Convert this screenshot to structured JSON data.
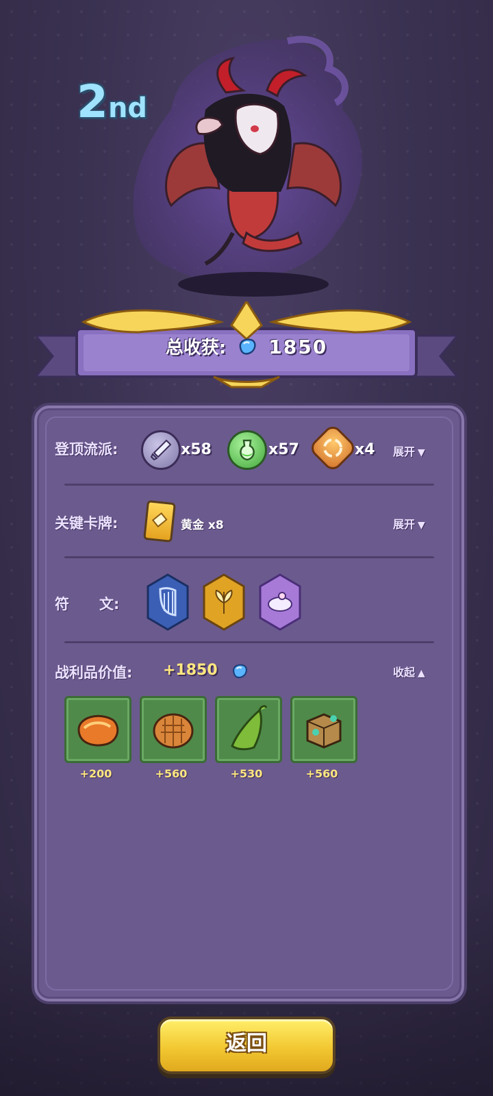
{
  "rank": {
    "number": "2",
    "suffix": "nd"
  },
  "banner": {
    "total_label": "总收获:",
    "total_value": "1850"
  },
  "rows": {
    "climb": {
      "label": "登顶流派:",
      "items": [
        {
          "icon": "sword-icon",
          "count": "x58"
        },
        {
          "icon": "potion-icon",
          "count": "x57"
        },
        {
          "icon": "swirl-icon",
          "count": "x4"
        }
      ],
      "toggle": "展开"
    },
    "cards": {
      "label": "关键卡牌:",
      "card_name": "黄金",
      "card_count": "x8",
      "toggle": "展开"
    },
    "runes": {
      "label_char1": "符",
      "label_char2": "文:",
      "items": [
        "harp-rune-icon",
        "wheat-rune-icon",
        "cauldron-rune-icon"
      ]
    },
    "loot": {
      "label": "战利品价值:",
      "value": "+1850",
      "toggle": "收起",
      "items": [
        {
          "icon": "pie-icon",
          "amount": "+200"
        },
        {
          "icon": "bread-icon",
          "amount": "+560"
        },
        {
          "icon": "horn-icon",
          "amount": "+530"
        },
        {
          "icon": "chest-icon",
          "amount": "+560"
        }
      ]
    }
  },
  "back_button": "返回",
  "colors": {
    "panel": "#6b5a8e",
    "accent_gold": "#f2c832",
    "loot_bg": "#4f8a4a"
  }
}
